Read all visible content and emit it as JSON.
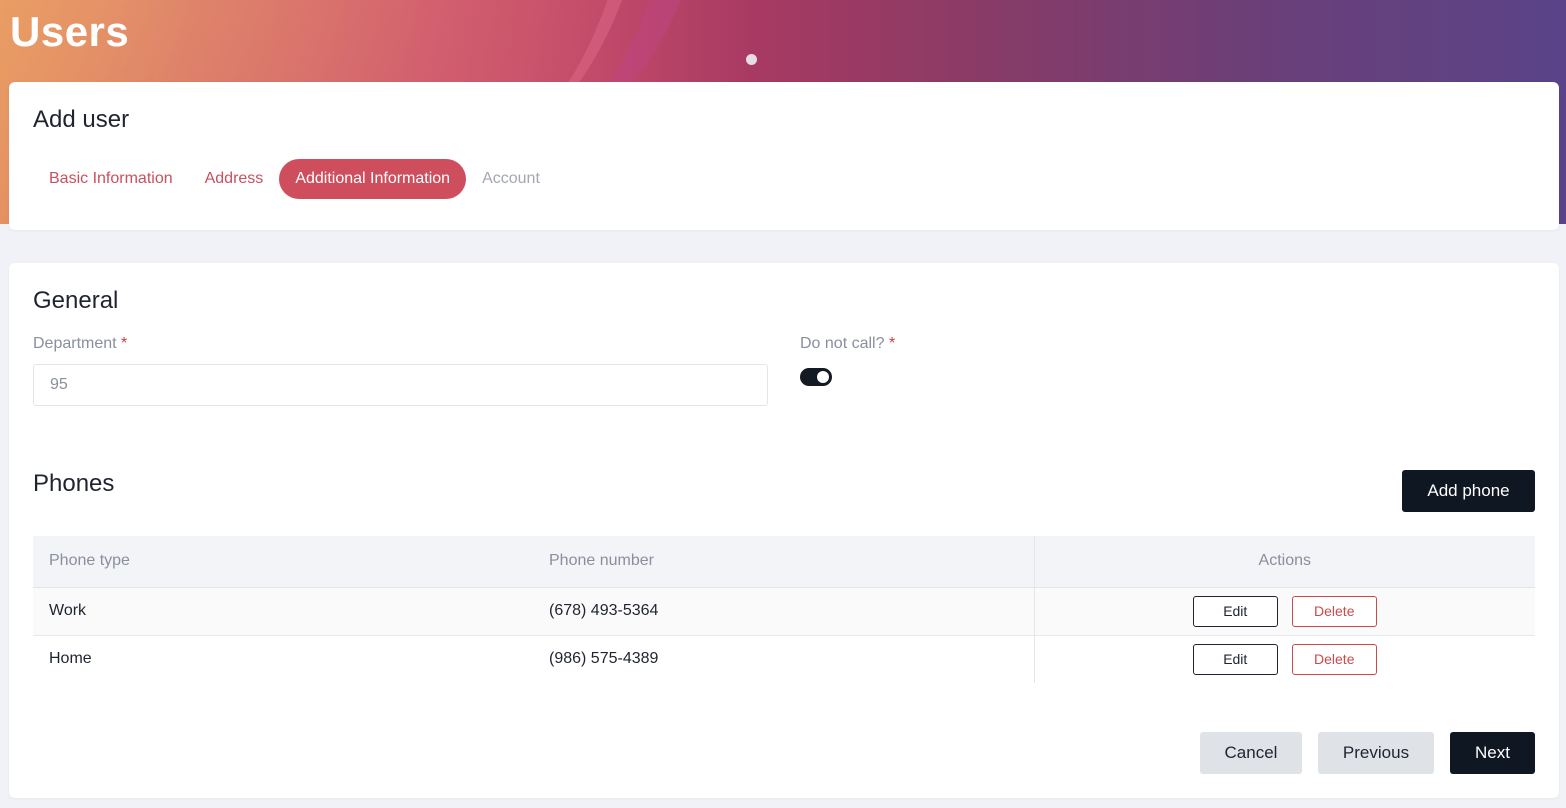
{
  "header": {
    "title": "Users"
  },
  "top_card": {
    "title": "Add user",
    "steps": [
      {
        "label": "Basic Information",
        "state": "done"
      },
      {
        "label": "Address",
        "state": "done"
      },
      {
        "label": "Additional Information",
        "state": "active"
      },
      {
        "label": "Account",
        "state": "disabled"
      }
    ]
  },
  "general": {
    "title": "General",
    "department": {
      "label": "Department",
      "required_mark": "*",
      "value": "95"
    },
    "do_not_call": {
      "label": "Do not call?",
      "required_mark": "*",
      "checked": true
    }
  },
  "phones": {
    "title": "Phones",
    "add_label": "Add phone",
    "columns": [
      "Phone type",
      "Phone number",
      "Actions"
    ],
    "rows": [
      {
        "type": "Work",
        "number": "(678) 493-5364",
        "edit_label": "Edit",
        "delete_label": "Delete"
      },
      {
        "type": "Home",
        "number": "(986) 575-4389",
        "edit_label": "Edit",
        "delete_label": "Delete"
      }
    ]
  },
  "footer": {
    "cancel_label": "Cancel",
    "previous_label": "Previous",
    "next_label": "Next"
  },
  "colors": {
    "accent": "#cf4e5e",
    "dark": "#0f1722",
    "danger": "#c94a4a"
  }
}
